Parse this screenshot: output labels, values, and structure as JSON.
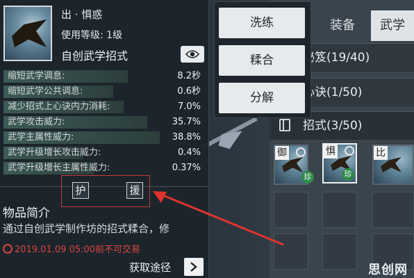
{
  "tabs": {
    "equipment": "装备",
    "martial_arts": "武学"
  },
  "categories": [
    {
      "label": "秘笈(19/40)"
    },
    {
      "label": "心诀(1/50)"
    },
    {
      "label": "招式(3/50)"
    }
  ],
  "skill_slots": [
    {
      "char": "御",
      "rare": null,
      "selected": false
    },
    {
      "char": "惧",
      "rare": "珍",
      "selected": true
    },
    {
      "char": "比",
      "rare": null,
      "selected": false
    }
  ],
  "context_menu": {
    "items": [
      "洗练",
      "糅合",
      "分解"
    ]
  },
  "item": {
    "name": "出 · 惧惑",
    "level_req": "使用等级: 1级",
    "type": "自创武学招式"
  },
  "stats": [
    {
      "name": "缩短武学调息:",
      "value": "8.2秒",
      "fill": 0.62
    },
    {
      "name": "缩短武学公共调息:",
      "value": "0.6秒",
      "fill": 0.55
    },
    {
      "name": "减少招式上心诀内力消耗:",
      "value": "7.0%",
      "fill": 0.6
    },
    {
      "name": "武学攻击威力:",
      "value": "35.7%",
      "fill": 0.72
    },
    {
      "name": "武学主属性威力:",
      "value": "38.8%",
      "fill": 0.78
    },
    {
      "name": "武学升级增长攻击威力:",
      "value": "0.4%",
      "fill": 0.4
    },
    {
      "name": "武学升级增长主属性威力:",
      "value": "0.37%",
      "fill": 0.45
    }
  ],
  "gems": [
    "护",
    "援"
  ],
  "intro": {
    "title": "物品简介",
    "text": "通过自创武学制作坊的招式糅合，修",
    "trade_notice": "2019.01.09 05:00前不可交易"
  },
  "source_label": "获取途径",
  "watermark": "思创网",
  "colors": {
    "arrow": "#e0342e",
    "trade_notice": "#d9463f",
    "rare_badge": "#2f8a4a"
  }
}
